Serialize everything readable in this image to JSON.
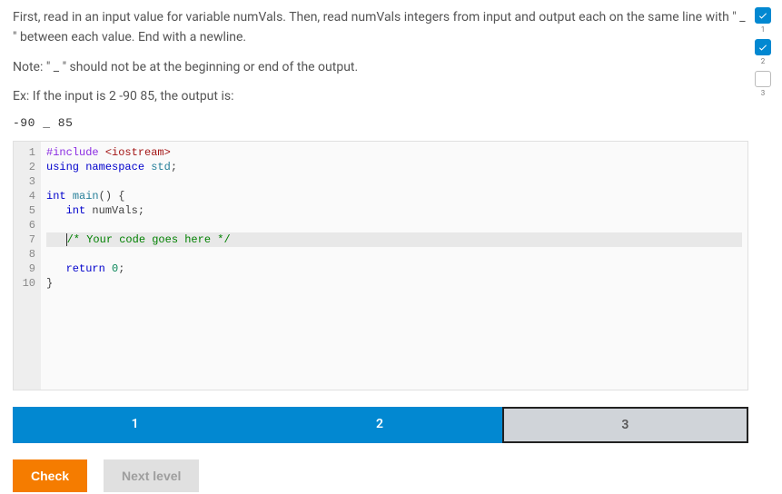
{
  "instructions": {
    "p1": "First, read in an input value for variable numVals. Then, read numVals integers from input and output each on the same line with \" _ \" between each value. End with a newline.",
    "p2": "Note: \" _ \" should not be at the beginning or end of the output.",
    "p3": "Ex: If the input is 2 -90 85, the output is:",
    "example_output": "-90 _ 85"
  },
  "code": {
    "lines": [
      {
        "n": "1",
        "html": "<span class='kw1'>#include</span> <span class='str'>&lt;iostream&gt;</span>"
      },
      {
        "n": "2",
        "html": "<span class='kw2'>using</span> <span class='kw2'>namespace</span> <span class='id'>std</span>;"
      },
      {
        "n": "3",
        "html": ""
      },
      {
        "n": "4",
        "html": "<span class='type'>int</span> <span class='id'>main</span>() {"
      },
      {
        "n": "5",
        "html": "   <span class='type'>int</span> numVals;"
      },
      {
        "n": "6",
        "html": ""
      },
      {
        "n": "7",
        "html": "   <span class='caret'></span><span class='cmt'>/* Your code goes here */</span>",
        "highlight": true
      },
      {
        "n": "8",
        "html": ""
      },
      {
        "n": "9",
        "html": "   <span class='kw2'>return</span> <span class='num'>0</span>;"
      },
      {
        "n": "10",
        "html": "}"
      }
    ]
  },
  "tabs": {
    "items": [
      {
        "label": "1",
        "state": "active-blue"
      },
      {
        "label": "2",
        "state": "active-blue"
      },
      {
        "label": "3",
        "state": "inactive-grey"
      }
    ]
  },
  "buttons": {
    "check": "Check",
    "next": "Next level"
  },
  "side_progress": {
    "items": [
      {
        "label": "1",
        "done": true
      },
      {
        "label": "2",
        "done": true
      },
      {
        "label": "3",
        "done": false
      }
    ]
  }
}
